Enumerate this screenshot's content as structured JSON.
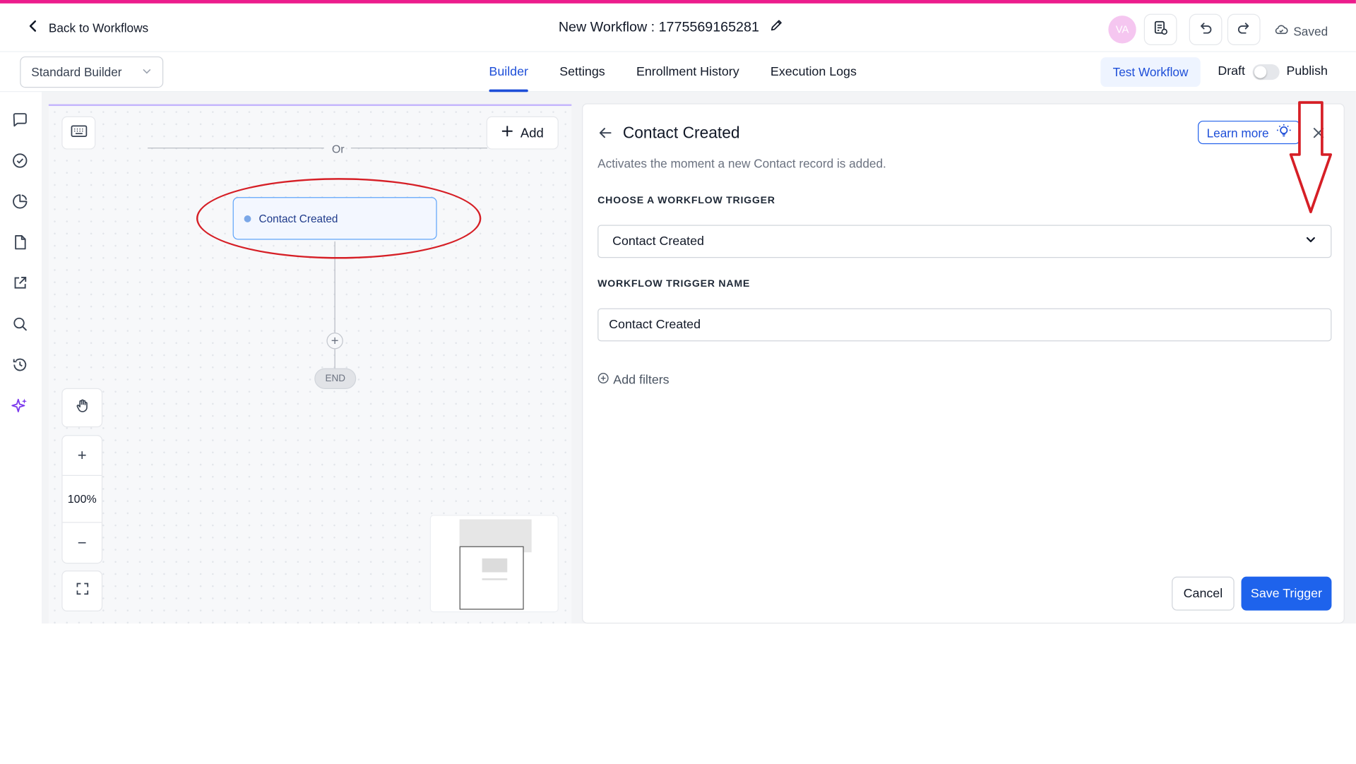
{
  "header": {
    "back_label": "Back to Workflows",
    "workflow_title": "New Workflow : 1775569165281",
    "avatar_initials": "VA",
    "saved_label": "Saved"
  },
  "subbar": {
    "builder_select": "Standard Builder",
    "tabs": [
      "Builder",
      "Settings",
      "Enrollment History",
      "Execution Logs"
    ],
    "active_tab": "Builder",
    "test_workflow": "Test Workflow",
    "draft_label": "Draft",
    "publish_label": "Publish",
    "publish_toggle_on": false
  },
  "sidebar_icons": [
    "chat-icon",
    "check-circle-icon",
    "pie-chart-icon",
    "document-icon",
    "external-link-icon",
    "search-icon",
    "history-icon",
    "sparkle-icon"
  ],
  "canvas": {
    "or_label": "Or",
    "add_label": "Add",
    "trigger_node_label": "Contact Created",
    "end_label": "END",
    "zoom_level": "100%"
  },
  "panel": {
    "title": "Contact Created",
    "description": "Activates the moment a new Contact record is added.",
    "learn_more": "Learn more",
    "choose_trigger_label": "CHOOSE A WORKFLOW TRIGGER",
    "selected_trigger": "Contact Created",
    "trigger_name_label": "WORKFLOW TRIGGER NAME",
    "trigger_name_value": "Contact Created",
    "add_filters": "Add filters",
    "cancel_label": "Cancel",
    "save_label": "Save Trigger"
  },
  "colors": {
    "accent": "#1e63ec",
    "top_line": "#ec1c8c",
    "annotation_red": "#d61f26"
  }
}
